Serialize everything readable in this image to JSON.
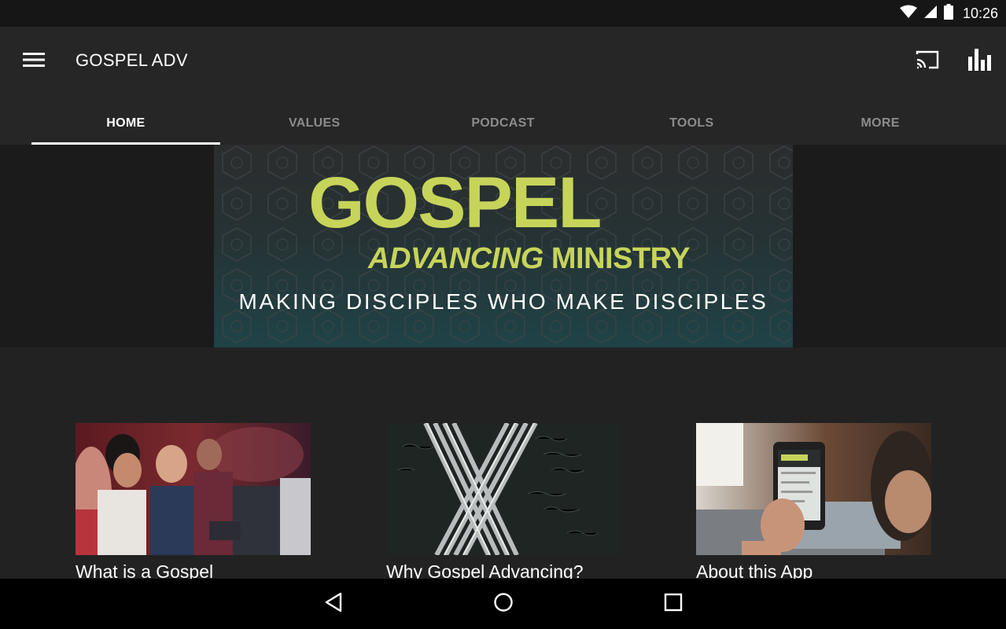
{
  "status_bar": {
    "time": "10:26",
    "icons": [
      "wifi-icon",
      "cellular-signal-icon",
      "battery-icon"
    ]
  },
  "app_bar": {
    "title": "GOSPEL ADV",
    "icons": [
      "menu-icon",
      "cast-icon",
      "bar-chart-icon"
    ]
  },
  "tabs": [
    {
      "label": "HOME",
      "active": true
    },
    {
      "label": "VALUES",
      "active": false
    },
    {
      "label": "PODCAST",
      "active": false
    },
    {
      "label": "TOOLS",
      "active": false
    },
    {
      "label": "MORE",
      "active": false
    }
  ],
  "banner": {
    "title": "GOSPEL",
    "subtitle_italic": "ADVANCING",
    "subtitle_rest": " MINISTRY",
    "tagline": "MAKING DISCIPLES WHO MAKE DISCIPLES"
  },
  "cards": [
    {
      "caption": "What is a Gospel",
      "image": "audience-photo"
    },
    {
      "caption": "Why Gospel Advancing?",
      "image": "silver-x-photo"
    },
    {
      "caption": "About this App",
      "image": "phone-app-photo"
    }
  ],
  "nav_bar": {
    "icons": [
      "back-icon",
      "home-icon",
      "recents-icon"
    ]
  },
  "colors": {
    "accent_green": "#c7d45a",
    "app_bar_bg": "#262626",
    "status_bar_bg": "#161616",
    "tab_inactive": "#8c8c8c"
  }
}
